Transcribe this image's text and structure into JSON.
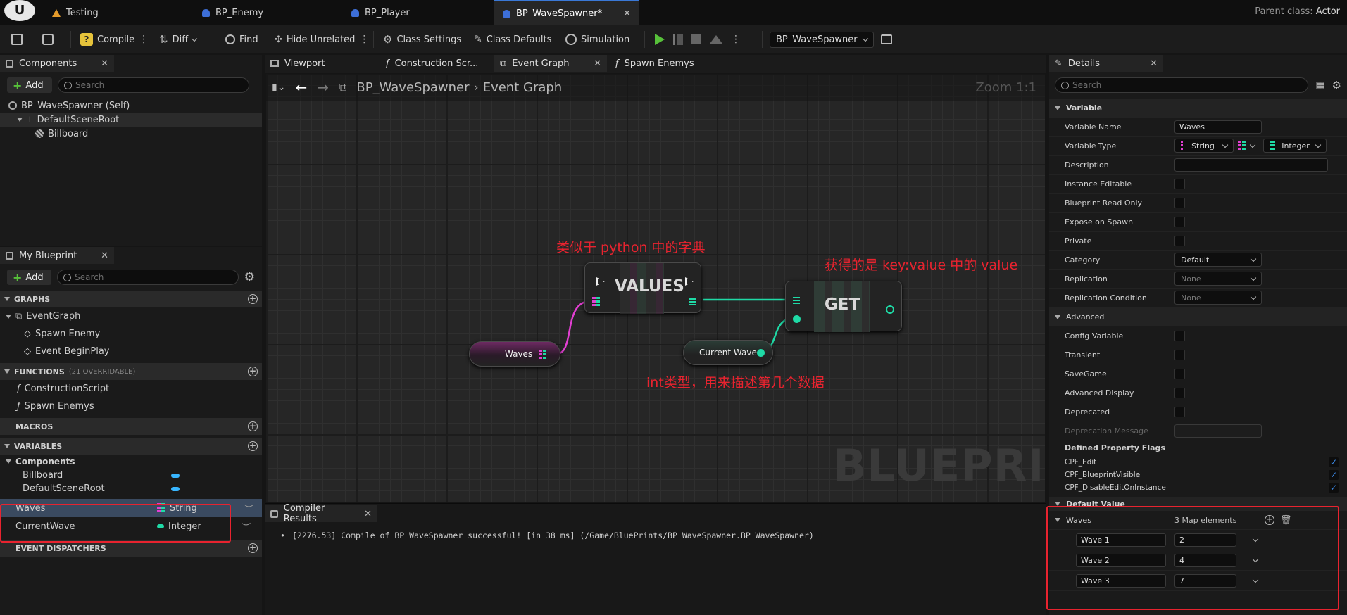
{
  "titlebar": {
    "logo": "U",
    "tabs": [
      {
        "label": "Testing"
      },
      {
        "label": "BP_Enemy"
      },
      {
        "label": "BP_Player"
      },
      {
        "label": "BP_WaveSpawner*"
      }
    ],
    "parent_class_label": "Parent class:",
    "parent_class_value": "Actor"
  },
  "toolbar": {
    "compile": "Compile",
    "diff": "Diff",
    "find": "Find",
    "hide_unrelated": "Hide Unrelated",
    "class_settings": "Class Settings",
    "class_defaults": "Class Defaults",
    "simulation": "Simulation",
    "debug_object": "BP_WaveSpawner"
  },
  "components_panel": {
    "title": "Components",
    "add": "Add",
    "search_placeholder": "Search",
    "tree": [
      "BP_WaveSpawner (Self)",
      "DefaultSceneRoot",
      "Billboard"
    ]
  },
  "my_blueprint": {
    "title": "My Blueprint",
    "add": "Add",
    "search_placeholder": "Search",
    "graphs_header": "GRAPHS",
    "graphs": [
      "EventGraph",
      "Spawn Enemy",
      "Event BeginPlay"
    ],
    "functions_header": "FUNCTIONS",
    "functions_note": "(21 OVERRIDABLE)",
    "functions": [
      "ConstructionScript",
      "Spawn Enemys"
    ],
    "macros_header": "MACROS",
    "variables_header": "VARIABLES",
    "components_group": "Components",
    "component_vars": [
      "Billboard",
      "DefaultSceneRoot"
    ],
    "variables": [
      {
        "name": "Waves",
        "type": "String"
      },
      {
        "name": "CurrentWave",
        "type": "Integer"
      }
    ],
    "dispatchers_header": "EVENT DISPATCHERS"
  },
  "editor_tabs": [
    "Viewport",
    "Construction Scr...",
    "Event Graph",
    "Spawn Enemys"
  ],
  "graph": {
    "breadcrumb_root": "BP_WaveSpawner",
    "breadcrumb_leaf": "Event Graph",
    "zoom": "Zoom 1:1",
    "watermark": "BLUEPRINT",
    "nodes": {
      "values": "VALUES",
      "get": "GET",
      "waves": "Waves",
      "current_wave": "Current Wave"
    },
    "annotations": {
      "dict": "类似于 python 中的字典",
      "getvalue": "获得的是 key:value 中的 value",
      "int": "int类型，用来描述第几个数据"
    }
  },
  "compiler": {
    "title": "Compiler Results",
    "message": "[2276.53] Compile of BP_WaveSpawner successful! [in 38 ms] (/Game/BluePrints/BP_WaveSpawner.BP_WaveSpawner)"
  },
  "details": {
    "title": "Details",
    "search_placeholder": "Search",
    "variable_section": "Variable",
    "variable_name_label": "Variable Name",
    "variable_name_value": "Waves",
    "variable_type_label": "Variable Type",
    "variable_type_key": "String",
    "variable_type_value": "Integer",
    "description_label": "Description",
    "instance_editable": "Instance Editable",
    "bp_read_only": "Blueprint Read Only",
    "expose_on_spawn": "Expose on Spawn",
    "private": "Private",
    "category_label": "Category",
    "category_value": "Default",
    "replication_label": "Replication",
    "replication_value": "None",
    "replication_condition_label": "Replication Condition",
    "replication_condition_value": "None",
    "advanced_section": "Advanced",
    "config_variable": "Config Variable",
    "transient": "Transient",
    "savegame": "SaveGame",
    "advanced_display": "Advanced Display",
    "deprecated": "Deprecated",
    "deprecation_message": "Deprecation Message",
    "property_flags_label": "Defined Property Flags",
    "flags": [
      "CPF_Edit",
      "CPF_BlueprintVisible",
      "CPF_DisableEditOnInstance"
    ],
    "default_value_section": "Default Value",
    "map_label": "Waves",
    "map_count": "3 Map elements",
    "map_entries": [
      {
        "key": "Wave 1",
        "value": "2"
      },
      {
        "key": "Wave 2",
        "value": "4"
      },
      {
        "key": "Wave 3",
        "value": "7"
      }
    ]
  },
  "colors": {
    "accent_blue": "#3a78d6",
    "annotation_red": "#e8232f",
    "string_pin": "#e23fd2",
    "int_pin": "#1fdaa6",
    "play_green": "#57c13a"
  }
}
